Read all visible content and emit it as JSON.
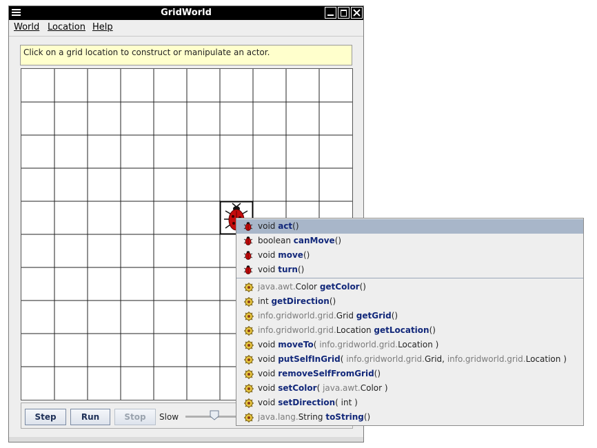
{
  "window": {
    "title": "GridWorld",
    "menus": [
      "World",
      "Location",
      "Help"
    ],
    "message": "Click on a grid location to construct or manipulate an actor."
  },
  "grid": {
    "rows": 10,
    "cols": 10,
    "bug_location": {
      "row": 4,
      "col": 6
    }
  },
  "controls": {
    "step_label": "Step",
    "run_label": "Run",
    "stop_label": "Stop",
    "speed_label": "Slow",
    "speed_fraction": 0.35
  },
  "popup": {
    "bug_methods": [
      {
        "ret": "void ",
        "name": "act",
        "params": "()"
      },
      {
        "ret": "boolean ",
        "name": "canMove",
        "params": "()"
      },
      {
        "ret": "void ",
        "name": "move",
        "params": "()"
      },
      {
        "ret": "void ",
        "name": "turn",
        "params": "()"
      }
    ],
    "actor_methods": [
      {
        "retpkg": "java.awt.",
        "ret": "Color ",
        "name": "getColor",
        "params": "()"
      },
      {
        "ret": "int ",
        "name": "getDirection",
        "params": "()"
      },
      {
        "retpkg": "info.gridworld.grid.",
        "ret": "Grid ",
        "name": "getGrid",
        "params": "()"
      },
      {
        "retpkg": "info.gridworld.grid.",
        "ret": "Location ",
        "name": "getLocation",
        "params": "()"
      },
      {
        "ret": "void ",
        "name": "moveTo",
        "params_open": "( ",
        "p1pkg": "info.gridworld.grid.",
        "p1": "Location",
        "params_close": " )"
      },
      {
        "ret": "void ",
        "name": "putSelfInGrid",
        "params_open": "( ",
        "p1pkg": "info.gridworld.grid.",
        "p1": "Grid",
        "sep": ", ",
        "p2pkg": "info.gridworld.grid.",
        "p2": "Location",
        "params_close": " )"
      },
      {
        "ret": "void ",
        "name": "removeSelfFromGrid",
        "params": "()"
      },
      {
        "ret": "void ",
        "name": "setColor",
        "params_open": "( ",
        "p1pkg": "java.awt.",
        "p1": "Color",
        "params_close": " )"
      },
      {
        "ret": "void ",
        "name": "setDirection",
        "params_open": "( ",
        "p1": "int",
        "params_close": " )"
      },
      {
        "retpkg": "java.lang.",
        "ret": "String ",
        "name": "toString",
        "params": "()"
      }
    ],
    "selected_index": 0
  },
  "colors": {
    "titlebar": "#000000",
    "selection": "#a8b6c9",
    "method_name": "#12287a",
    "message_bg": "#ffffcc",
    "bug_red": "#c40c0c"
  }
}
